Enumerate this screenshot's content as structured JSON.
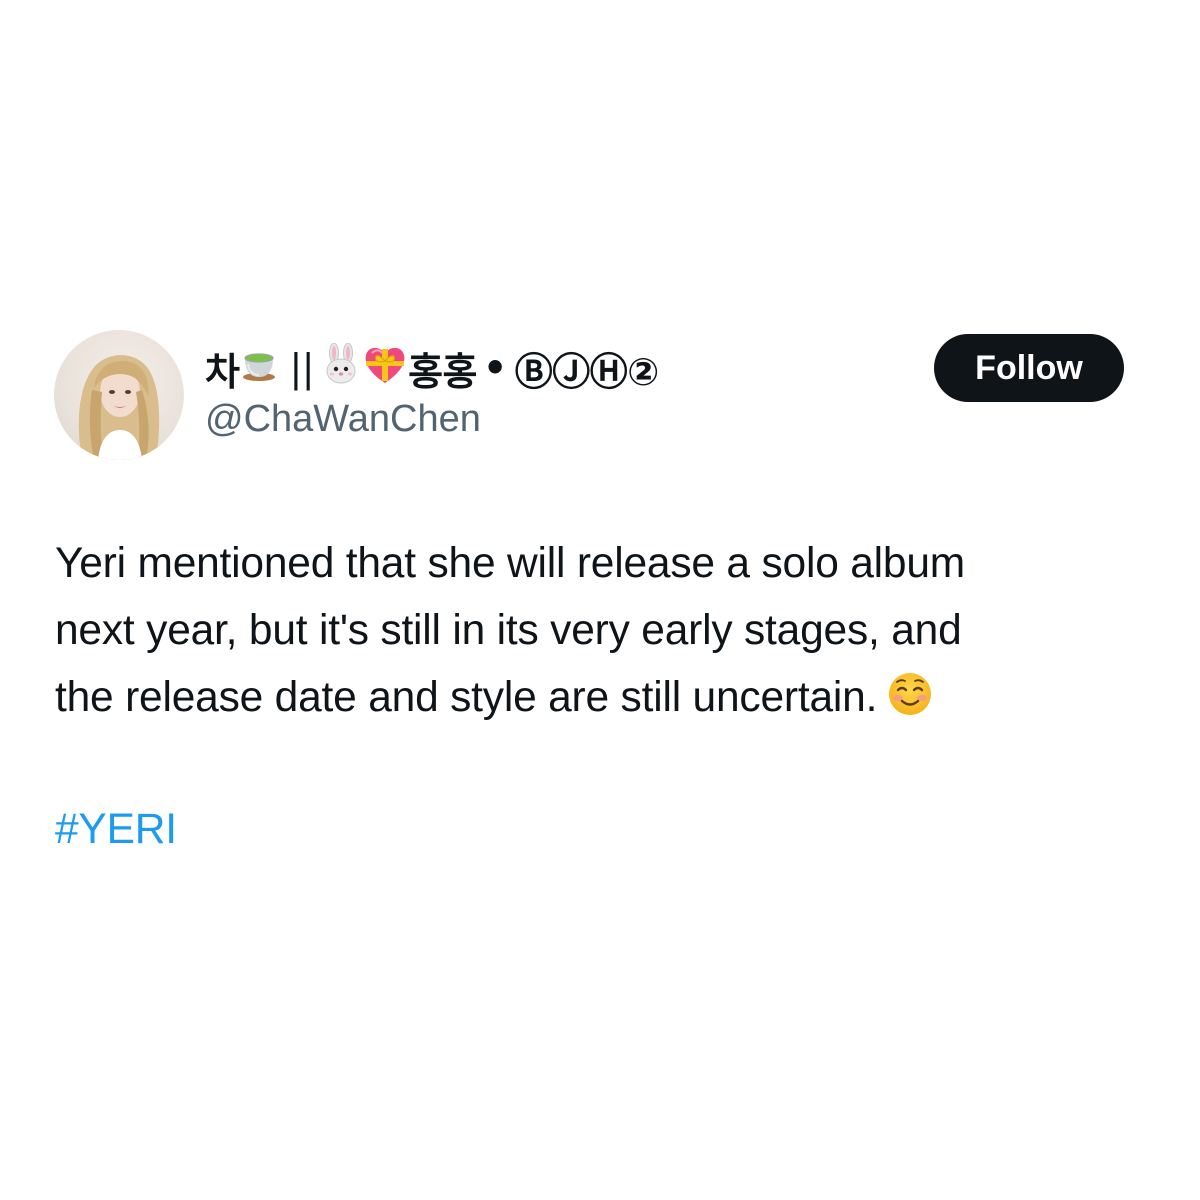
{
  "tweet": {
    "author": {
      "name_prefix": "차",
      "name_separator": "||",
      "name_korean": "홍홍",
      "name_bullet": "•",
      "name_suffix": "ⒷⒿⒽ②",
      "handle": "@ChaWanChen",
      "avatar": "profile-photo",
      "name_icons": [
        "tea-cup-icon",
        "rabbit-face-icon",
        "heart-with-ribbon-icon"
      ]
    },
    "follow_label": "Follow",
    "body_lines": "Yeri mentioned that she will release a solo album\nnext year, but it's still in its very early stages, and\nthe release date and style are still uncertain.",
    "body_emoji": "smiling-face-icon",
    "hashtag": "#YERI"
  },
  "colors": {
    "text": "#0f1419",
    "secondary": "#536471",
    "link": "#1d9bf0",
    "button_bg": "#0f1419",
    "button_text": "#ffffff"
  }
}
